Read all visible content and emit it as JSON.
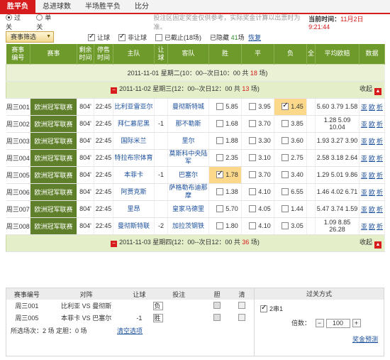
{
  "tabs": [
    {
      "label": "胜平负"
    },
    {
      "label": "总进球数"
    },
    {
      "label": "半场胜平负"
    },
    {
      "label": "比分"
    }
  ],
  "mode": {
    "pass": "过关",
    "single": "单关"
  },
  "notice": "投注区固定奖金仅供参考，实际奖金计算以出票时为准。",
  "time": {
    "label": "当前时间：",
    "date": "11月2日",
    "clock": "9:21:44"
  },
  "filter": {
    "button": "赛事筛选",
    "handicap": "让球",
    "no_handicap": "非让球",
    "ended": "已截止(18场)",
    "hidden_prefix": "已隐藏",
    "hidden_count": "41",
    "hidden_suffix": "场",
    "restore": "恢复"
  },
  "headers": {
    "id": "赛事\n编号",
    "league": "赛事",
    "remain": "剩余\n时间",
    "stop": "停售\n时间",
    "home": "主队",
    "hc": "让\n球",
    "away": "客队",
    "win": "胜",
    "draw": "平",
    "lose": "负",
    "all": "全",
    "avg": "平均欧赔",
    "data": "数据"
  },
  "days": [
    {
      "prefix": "2011-11-01 星期二(10：00--次日10：00 共 ",
      "count": "18",
      "suffix": " 场)"
    },
    {
      "prefix": "2011-11-02 星期三(12：00--次日12：00 共 ",
      "count": "13",
      "suffix": " 场)",
      "collapse": "收起"
    },
    {
      "prefix": "2011-11-03 星期四(12：00--次日12：00 共 ",
      "count": "36",
      "suffix": " 场)",
      "collapse": "收起"
    }
  ],
  "data_links": [
    "亚",
    "欧",
    "析"
  ],
  "matches": [
    {
      "id": "周三001",
      "league": "欧洲冠军联赛",
      "remain": "804'",
      "stop": "22:45",
      "home": "比利亚雷亚尔",
      "hc": "",
      "away": "曼彻斯特城",
      "win": "5.85",
      "draw": "3.95",
      "lose": "1.45",
      "avg": "5.60 3.79 1.58"
    },
    {
      "id": "周三002",
      "league": "欧洲冠军联赛",
      "remain": "804'",
      "stop": "22:45",
      "home": "拜仁慕尼黑",
      "hc": "-1",
      "away": "那不勒斯",
      "win": "1.68",
      "draw": "3.70",
      "lose": "3.85",
      "avg": "1.28 5.09 10.04"
    },
    {
      "id": "周三003",
      "league": "欧洲冠军联赛",
      "remain": "804'",
      "stop": "22:45",
      "home": "国际米兰",
      "hc": "",
      "away": "里尔",
      "win": "1.88",
      "draw": "3.30",
      "lose": "3.60",
      "avg": "1.93 3.27 3.90"
    },
    {
      "id": "周三004",
      "league": "欧洲冠军联赛",
      "remain": "804'",
      "stop": "22:45",
      "home": "特拉布宗体育",
      "hc": "",
      "away": "莫斯科中央陆军",
      "win": "2.35",
      "draw": "3.10",
      "lose": "2.75",
      "avg": "2.58 3.18 2.64"
    },
    {
      "id": "周三005",
      "league": "欧洲冠军联赛",
      "remain": "804'",
      "stop": "22:45",
      "home": "本菲卡",
      "hc": "-1",
      "away": "巴塞尔",
      "win": "1.78",
      "draw": "3.70",
      "lose": "3.40",
      "avg": "1.29 5.01 9.86"
    },
    {
      "id": "周三006",
      "league": "欧洲冠军联赛",
      "remain": "804'",
      "stop": "22:45",
      "home": "阿贾克斯",
      "hc": "",
      "away": "萨格勒布迪那摩",
      "win": "1.38",
      "draw": "4.10",
      "lose": "6.55",
      "avg": "1.46 4.02 6.71"
    },
    {
      "id": "周三007",
      "league": "欧洲冠军联赛",
      "remain": "804'",
      "stop": "22:45",
      "home": "里昂",
      "hc": "",
      "away": "皇家马德里",
      "win": "5.70",
      "draw": "4.05",
      "lose": "1.44",
      "avg": "5.47 3.74 1.59"
    },
    {
      "id": "周三008",
      "league": "欧洲冠军联赛",
      "remain": "804'",
      "stop": "22:45",
      "home": "曼彻斯特联",
      "hc": "-2",
      "away": "加拉茨钢铁",
      "win": "1.80",
      "draw": "4.10",
      "lose": "3.05",
      "avg": "1.09 8.85 26.28"
    }
  ],
  "betslip": {
    "headers": {
      "id": "赛事编号",
      "match": "对阵",
      "hc": "让球",
      "pick": "投注",
      "dan": "胆",
      "clear": "清"
    },
    "rows": [
      {
        "id": "周三001",
        "home": "比利亚",
        "vs": "VS",
        "away": "曼彻斯",
        "hc": "",
        "pick": "负"
      },
      {
        "id": "周三005",
        "home": "本菲卡",
        "vs": "VS",
        "away": "巴塞尔",
        "hc": "-1",
        "pick": "胜"
      }
    ],
    "summary": "所选场次：2 场  定胆：0 场",
    "clear_all": "清空选项"
  },
  "pass": {
    "title": "过关方式",
    "option": "2串1",
    "multiple_label": "倍数：",
    "multiple_value": "100",
    "minus": "−",
    "plus": "+",
    "predict": "奖金预测"
  }
}
